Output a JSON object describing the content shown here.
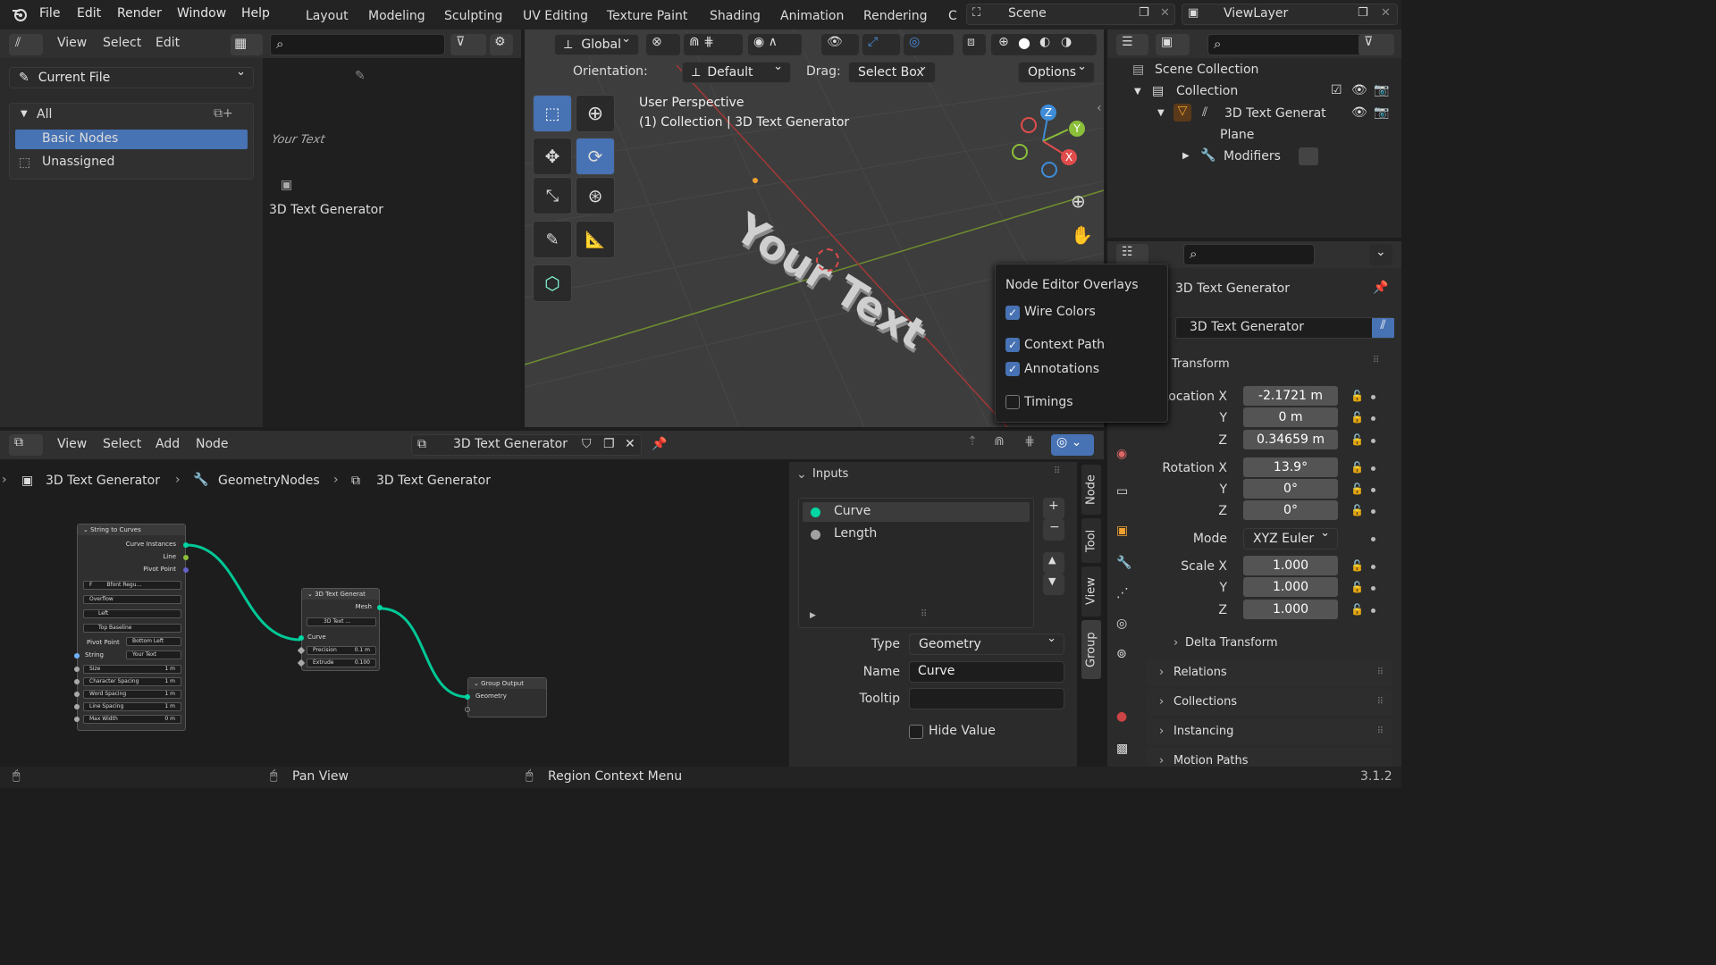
{
  "topbar": {
    "menus": [
      "File",
      "Edit",
      "Render",
      "Window",
      "Help"
    ],
    "workspaces": [
      "Layout",
      "Modeling",
      "Sculpting",
      "UV Editing",
      "Texture Paint",
      "Shading",
      "Animation",
      "Rendering",
      "C"
    ],
    "scene": "Scene",
    "view_layer": "ViewLayer"
  },
  "asset_browser": {
    "menus": [
      "View",
      "Select",
      "Edit"
    ],
    "library": "Current File",
    "catalogs": {
      "all": "All",
      "basic_nodes": "Basic Nodes",
      "unassigned": "Unassigned"
    },
    "asset_name": "3D Text Generator",
    "thumb_text": "Your Text"
  },
  "viewport": {
    "transform_orientation": "Global",
    "orientation_label": "Orientation:",
    "orientation_value": "Default",
    "drag_label": "Drag:",
    "drag_value": "Select Box",
    "options": "Options",
    "perspective": "User Perspective",
    "collection_info": "(1) Collection | 3D Text Generator",
    "text_object": "Your Text",
    "gizmo_axes": [
      "X",
      "Y",
      "Z"
    ]
  },
  "overlay_popup": {
    "title": "Node Editor Overlays",
    "items": [
      {
        "label": "Wire Colors",
        "checked": true
      },
      {
        "label": "Context Path",
        "checked": true
      },
      {
        "label": "Annotations",
        "checked": true
      },
      {
        "label": "Timings",
        "checked": false
      }
    ]
  },
  "outliner": {
    "scene_collection": "Scene Collection",
    "collection": "Collection",
    "object": "3D Text Generat",
    "mesh": "Plane",
    "modifiers": "Modifiers"
  },
  "properties": {
    "object_title": "3D Text Generator",
    "object_name": "3D Text Generator",
    "transform_header": "Transform",
    "location_label": "Location X",
    "location": [
      "-2.1721 m",
      "0 m",
      "0.34659 m"
    ],
    "rotation_label": "Rotation X",
    "rotation": [
      "13.9°",
      "0°",
      "0°"
    ],
    "mode_label": "Mode",
    "mode_value": "XYZ Euler",
    "scale_label": "Scale X",
    "scale": [
      "1.000",
      "1.000",
      "1.000"
    ],
    "axis_y": "Y",
    "axis_z": "Z",
    "sections": [
      "Delta Transform",
      "Relations",
      "Collections",
      "Instancing",
      "Motion Paths"
    ]
  },
  "node_editor": {
    "menus": [
      "View",
      "Select",
      "Add",
      "Node"
    ],
    "node_group": "3D Text Generator",
    "breadcrumb": [
      "3D Text Generator",
      "GeometryNodes",
      "3D Text Generator"
    ],
    "nodes": {
      "string_to_curves": {
        "title": "String to Curves",
        "outputs": [
          "Curve Instances",
          "Line",
          "Pivot Point"
        ],
        "font": "Bfont Regu...",
        "overflow": "Overflow",
        "align_x": "Left",
        "align_y": "Top Baseline",
        "pivot_label": "Pivot Point",
        "pivot_value": "Bottom Left",
        "string_label": "String",
        "string_value": "Your Text",
        "fields": [
          {
            "label": "Size",
            "value": "1 m"
          },
          {
            "label": "Character Spacing",
            "value": "1 m"
          },
          {
            "label": "Word Spacing",
            "value": "1 m"
          },
          {
            "label": "Line Spacing",
            "value": "1 m"
          },
          {
            "label": "Max Width",
            "value": "0 m"
          }
        ]
      },
      "text_gen": {
        "title": "3D Text Generat",
        "output": "Mesh",
        "group_name": "3D Text ...",
        "input": "Curve",
        "precision_label": "Precision",
        "precision_value": "0.1 m",
        "extrude_label": "Extrude",
        "extrude_value": "0.100"
      },
      "group_output": {
        "title": "Group Output",
        "input": "Geometry"
      }
    }
  },
  "sidebar": {
    "tabs": [
      "Node",
      "Tool",
      "View",
      "Group"
    ],
    "inputs_header": "Inputs",
    "inputs": [
      {
        "name": "Curve",
        "color": "#00d6a3"
      },
      {
        "name": "Length",
        "color": "#a1a1a1"
      }
    ],
    "type_label": "Type",
    "type_value": "Geometry",
    "name_label": "Name",
    "name_value": "Curve",
    "tooltip_label": "Tooltip",
    "tooltip_value": "",
    "hide_value": "Hide Value"
  },
  "statusbar": {
    "pan": "Pan View",
    "context": "Region Context Menu",
    "version": "3.1.2"
  },
  "colors": {
    "accent": "#4772b3",
    "wire": "#00d6a3",
    "x_axis": "#e04c4c",
    "y_axis": "#8bbf3a",
    "z_axis": "#3f8cd8"
  }
}
